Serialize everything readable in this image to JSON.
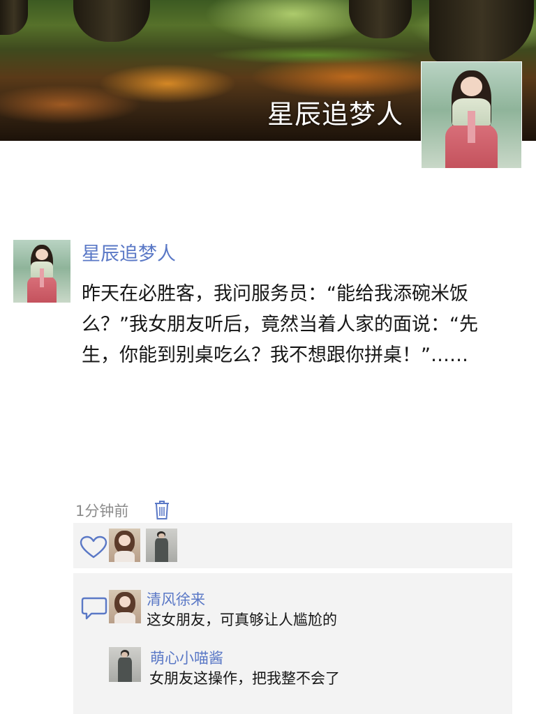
{
  "cover": {
    "title": "星辰追梦人"
  },
  "post": {
    "author": "星辰追梦人",
    "content": "昨天在必胜客，我问服务员：“能给我添碗米饭么？”我女朋友听后，竟然当着人家的面说：“先生，你能到别桌吃么？我不想跟你拼桌！”……",
    "time": "1分钟前",
    "icons": {
      "delete": "trash-icon",
      "like": "heart-icon",
      "comment": "comment-bubble-icon"
    }
  },
  "comments": [
    {
      "name": "清风徐来",
      "text": "这女朋友，可真够让人尴尬的"
    },
    {
      "name": "萌心小喵酱",
      "text": "女朋友这操作，把我整不会了"
    }
  ],
  "colors": {
    "link": "#5a78c6",
    "text": "#161616",
    "muted": "#8c8c8c",
    "panel": "#f3f3f3"
  }
}
